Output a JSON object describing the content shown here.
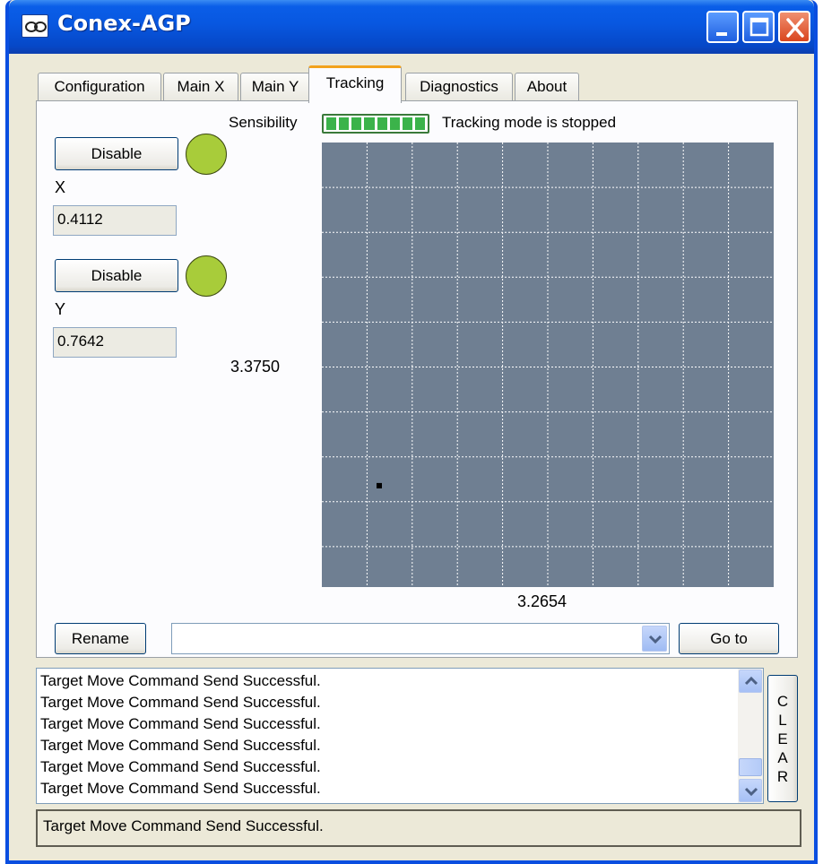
{
  "window": {
    "title": "Conex-AGP",
    "title_icon": "link-icon",
    "controls": [
      "minimize-icon",
      "maximize-icon",
      "close-icon"
    ]
  },
  "tabs": [
    {
      "label": "Configuration",
      "active": false
    },
    {
      "label": "Main X",
      "active": false
    },
    {
      "label": "Main Y",
      "active": false
    },
    {
      "label": "Tracking",
      "active": true
    },
    {
      "label": "Diagnostics",
      "active": false
    },
    {
      "label": "About",
      "active": false
    }
  ],
  "tracking": {
    "sensibility_label": "Sensibility",
    "sensibility_level": 1.0,
    "mode_status": "Tracking mode is stopped",
    "x_axis": {
      "button_label": "Disable",
      "indicator_color": "#a8cc3a",
      "label": "X",
      "value": "0.4112"
    },
    "y_axis": {
      "button_label": "Disable",
      "indicator_color": "#a8cc3a",
      "label": "Y",
      "value": "0.7642"
    },
    "plot": {
      "y_readout": "3.3750",
      "x_readout": "3.2654",
      "background_color": "#6f7f92",
      "grid": "10x9 dotted white",
      "target_position": {
        "x": 0.4112,
        "y": 0.7642
      }
    },
    "rename_label": "Rename",
    "position_select_value": "",
    "goto_label": "Go to"
  },
  "log": {
    "lines": [
      "Target Move Command Send Successful.",
      "Target Move Command Send Successful.",
      "Target Move Command Send Successful.",
      "Target Move Command Send Successful.",
      "Target Move Command Send Successful.",
      "Target Move Command Send Successful."
    ],
    "clear_label": [
      "C",
      "L",
      "E",
      "A",
      "R"
    ]
  },
  "status_text": "Target Move Command Send Successful."
}
